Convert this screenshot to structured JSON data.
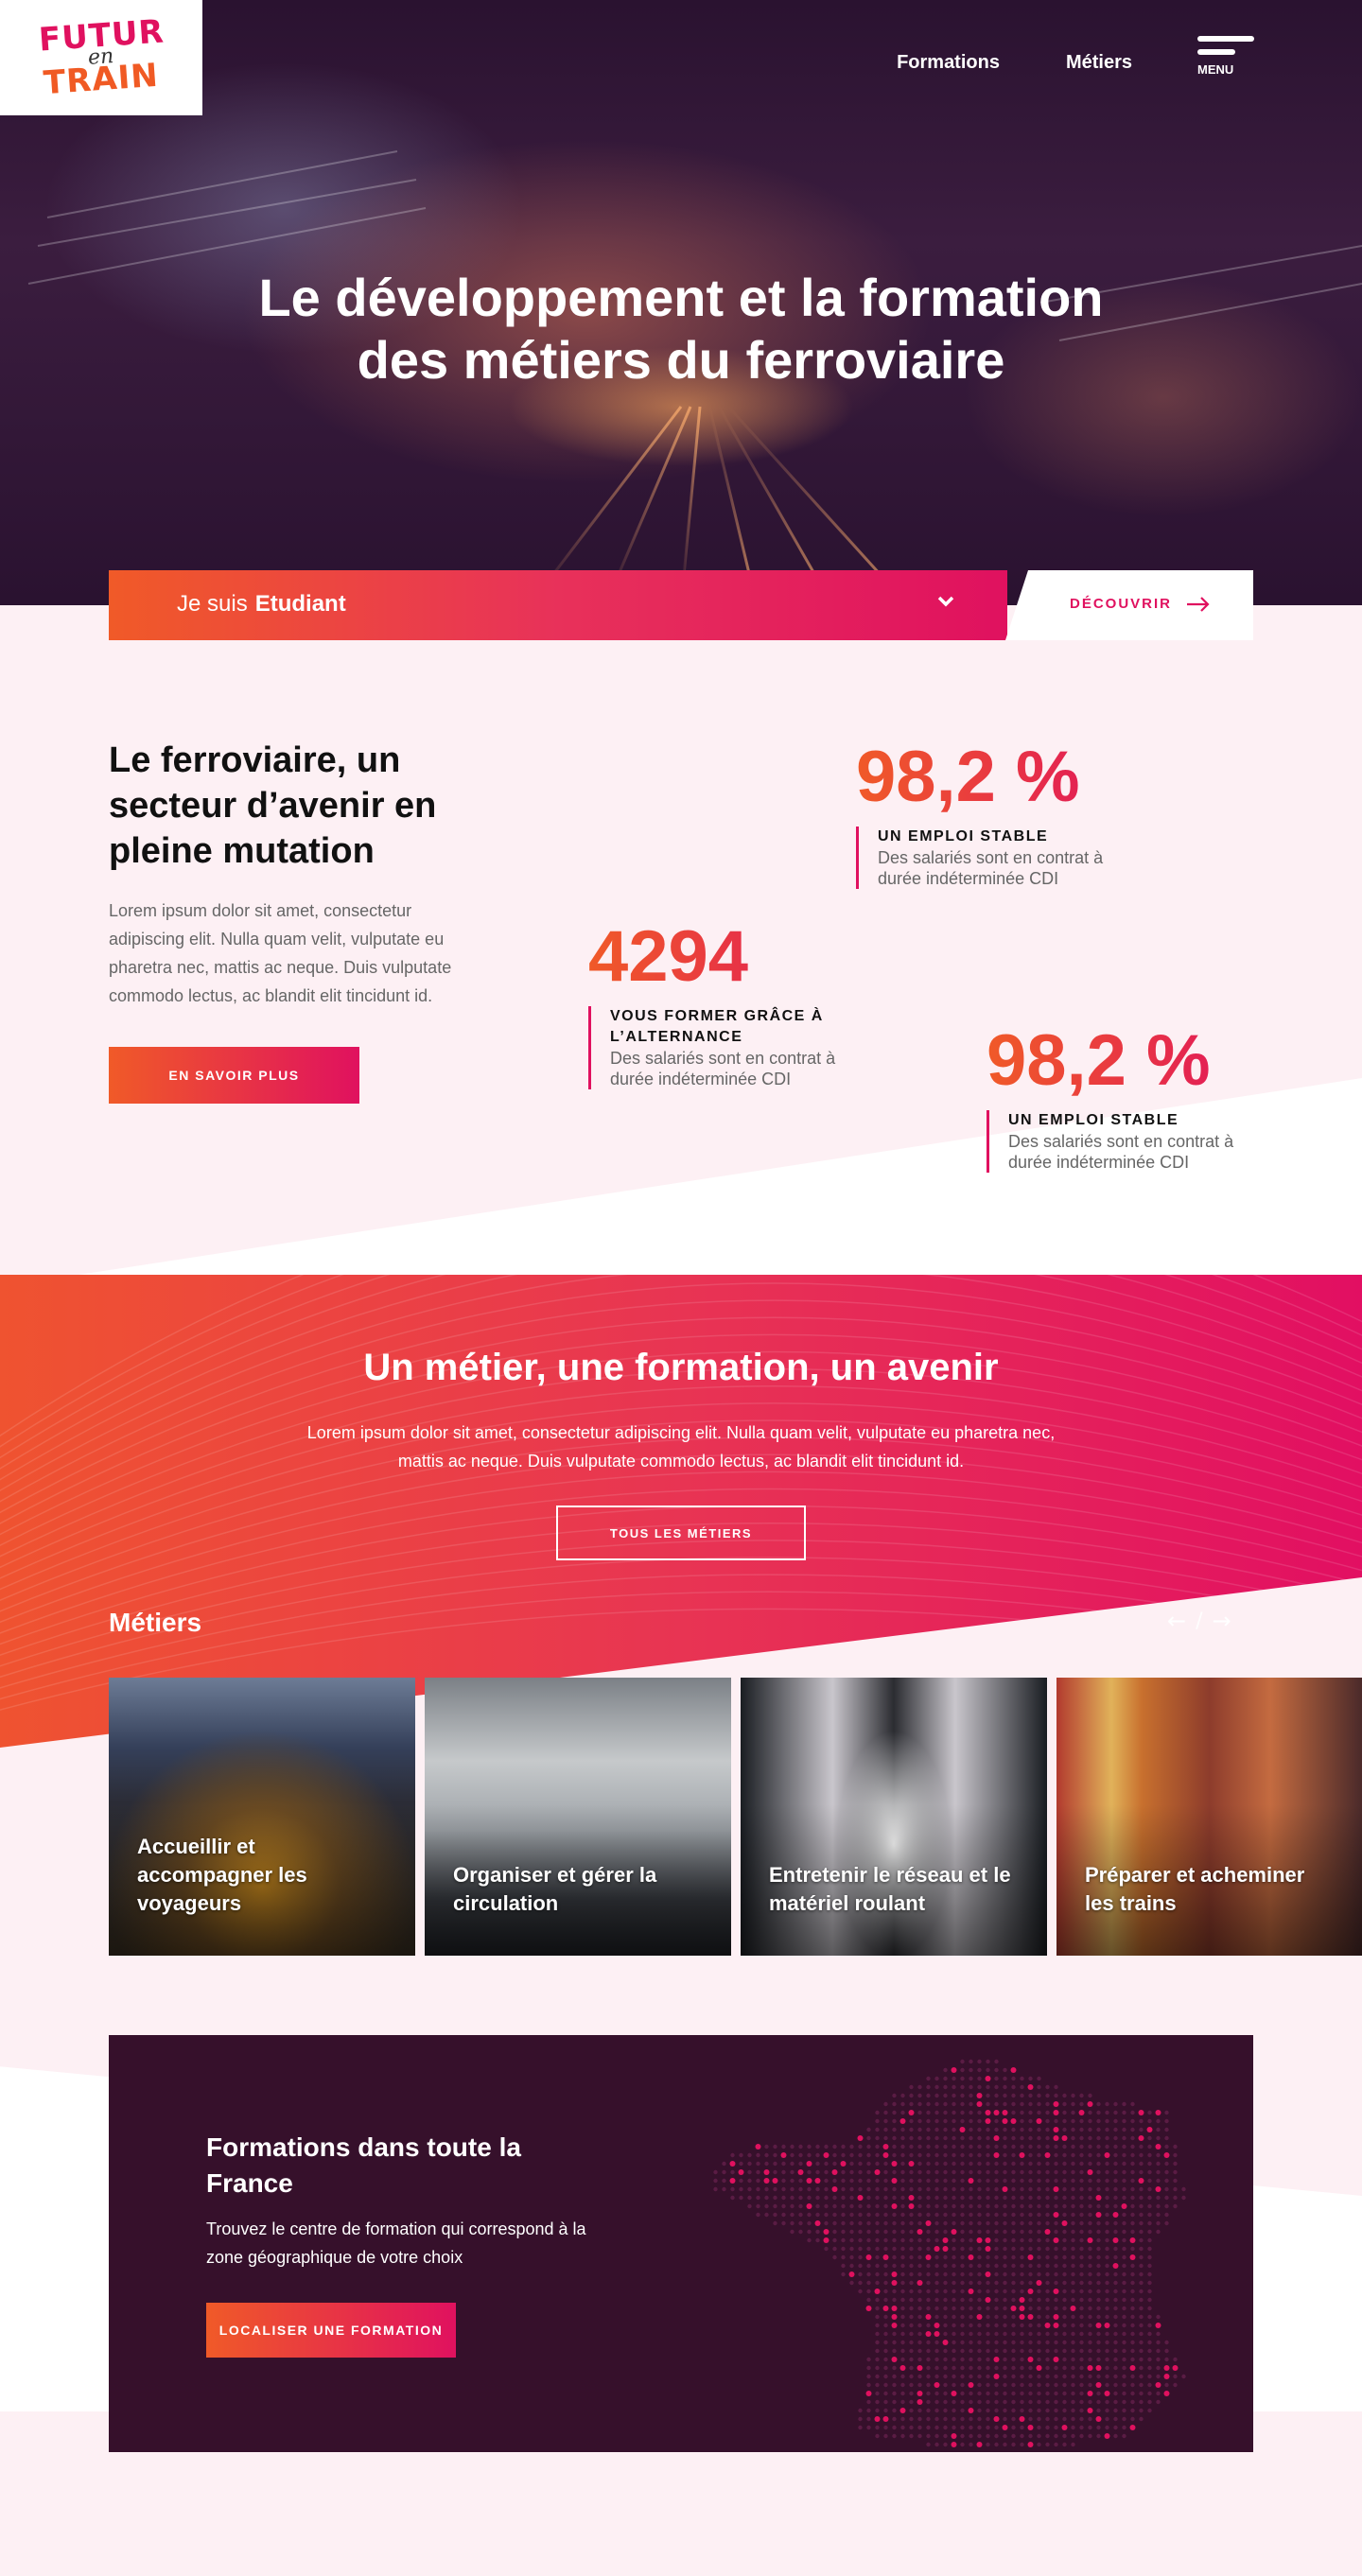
{
  "logo": {
    "line1": "FUTUR",
    "line2": "en",
    "line3": "TRAIN"
  },
  "nav": {
    "formations": "Formations",
    "metiers": "Métiers",
    "menu_label": "MENU"
  },
  "hero": {
    "title_line1": "Le développement et la formation",
    "title_line2": "des métiers du ferroviaire"
  },
  "selector": {
    "prefix": "Je suis",
    "value": "Etudiant",
    "cta": "DÉCOUVRIR"
  },
  "intro": {
    "title": "Le ferroviaire, un secteur d’avenir en pleine mutation",
    "text": "Lorem ipsum dolor sit amet, consectetur adipiscing elit. Nulla quam velit, vulputate eu pharetra nec, mattis ac neque. Duis vulputate commodo lectus, ac blandit elit tincidunt id.",
    "button": "EN SAVOIR PLUS"
  },
  "stats": [
    {
      "value": "98,2 %",
      "label": "UN EMPLOI STABLE",
      "desc": "Des salariés sont en contrat à durée indéterminée CDI"
    },
    {
      "value": "4294",
      "label": "VOUS FORMER GRÂCE À L’ALTERNANCE",
      "desc": "Des salariés sont en contrat à durée indéterminée CDI"
    },
    {
      "value": "98,2 %",
      "label": "UN EMPLOI STABLE",
      "desc": "Des salariés sont en contrat à durée indéterminée CDI"
    }
  ],
  "band": {
    "title": "Un métier, une formation, un avenir",
    "text": "Lorem ipsum dolor sit amet, consectetur adipiscing elit. Nulla quam velit, vulputate eu pharetra nec, mattis ac neque. Duis vulputate commodo lectus, ac blandit elit tincidunt id.",
    "button": "TOUS LES MÉTIERS",
    "metiers_title": "Métiers",
    "nav_prev": "←",
    "nav_sep": "/",
    "nav_next": "→"
  },
  "cards": [
    {
      "caption": "Accueillir et accompagner les voyageurs"
    },
    {
      "caption": "Organiser et gérer la circulation"
    },
    {
      "caption": "Entretenir le réseau et le matériel roulant"
    },
    {
      "caption": "Préparer et acheminer les trains"
    }
  ],
  "map": {
    "title": "Formations dans toute la France",
    "text": "Trouvez le centre de formation qui correspond à la zone géographique de votre choix",
    "button": "LOCALISER UNE FORMATION"
  },
  "colors": {
    "orange": "#f05a28",
    "pink": "#e0115f",
    "dark_purple": "#36102b",
    "bg_pink": "#fdf0f4"
  }
}
